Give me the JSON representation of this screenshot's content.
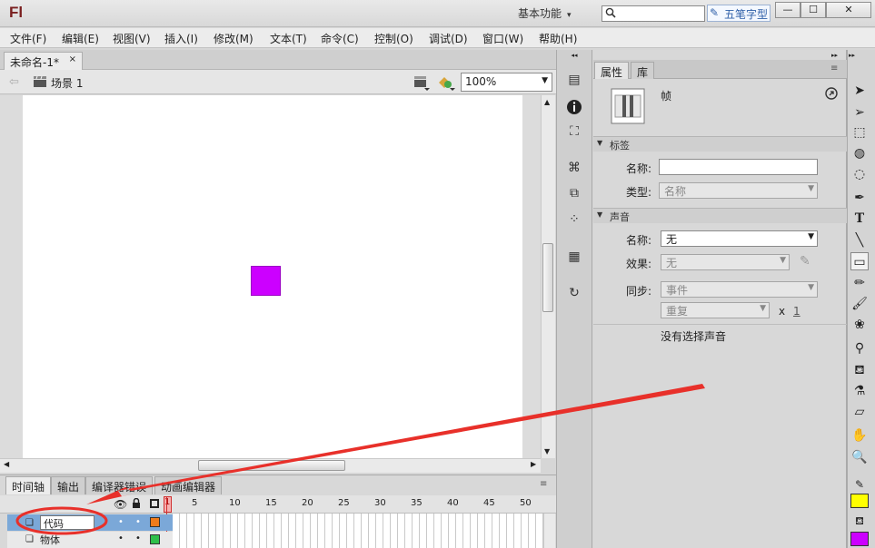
{
  "app": {
    "logo": "Fl",
    "workspace": "基本功能",
    "search_value": "",
    "ime_label": "五笔字型"
  },
  "window_buttons": [
    "—",
    "☐",
    "✕"
  ],
  "menu": [
    "文件(F)",
    "编辑(E)",
    "视图(V)",
    "插入(I)",
    "修改(M)",
    "文本(T)",
    "命令(C)",
    "控制(O)",
    "调试(D)",
    "窗口(W)",
    "帮助(H)"
  ],
  "document": {
    "tab_title": "未命名-1*",
    "tab_close": "×",
    "scene": "场景 1",
    "zoom": "100%"
  },
  "stage": {
    "shape_color": "#cc00ff"
  },
  "timeline": {
    "tabs": [
      "时间轴",
      "输出",
      "编译器错误",
      "动画编辑器"
    ],
    "frame_numbers": [
      "1",
      "5",
      "10",
      "15",
      "20",
      "25",
      "30",
      "35",
      "40",
      "45",
      "50"
    ],
    "layers": [
      {
        "name": "代码",
        "outline_color": "#f07b1b",
        "selected": true
      },
      {
        "name": "物体",
        "outline_color": "#2fbf4a",
        "selected": false
      }
    ]
  },
  "properties": {
    "tabs": [
      "属性",
      "库"
    ],
    "object_type": "帧",
    "section_label": "标签",
    "label_name_label": "名称:",
    "label_name_value": "",
    "label_type_label": "类型:",
    "label_type_value": "名称",
    "section_sound": "声音",
    "sound_name_label": "名称:",
    "sound_name_value": "无",
    "effect_label": "效果:",
    "effect_value": "无",
    "sync_label": "同步:",
    "sync_value": "事件",
    "repeat_value": "重复",
    "repeat_x": "x",
    "repeat_count": "1",
    "no_sound_text": "没有选择声音"
  },
  "colors": {
    "stroke_swatch": "#ffff00",
    "fill_swatch": "#cc00ff",
    "annotation": "#e8302a"
  }
}
